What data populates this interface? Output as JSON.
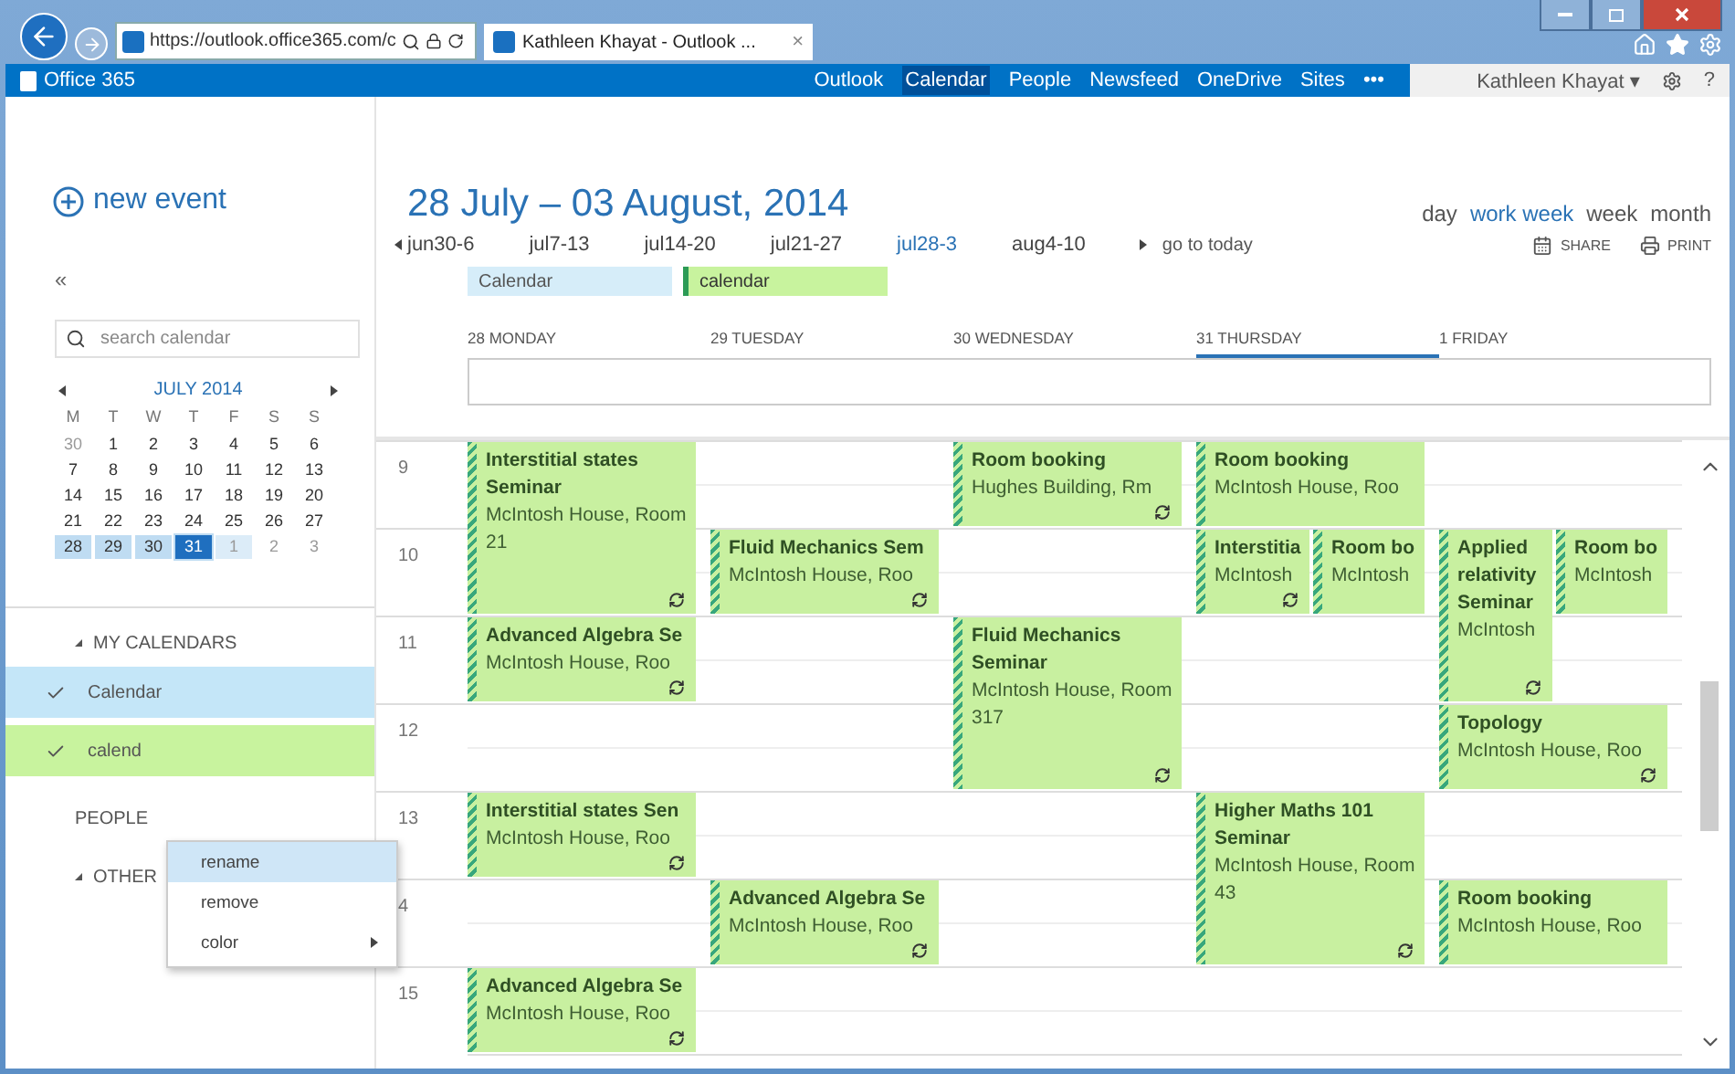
{
  "browser": {
    "address": "https://outlook.office365.com/c",
    "tab": {
      "title": "Kathleen Khayat - Outlook ...",
      "close": "×"
    }
  },
  "suite_bar": {
    "logo": "Office 365",
    "nav": [
      {
        "label": "Outlook",
        "selected": false
      },
      {
        "label": "Calendar",
        "selected": true
      },
      {
        "label": "People",
        "selected": false
      },
      {
        "label": "Newsfeed",
        "selected": false
      },
      {
        "label": "OneDrive",
        "selected": false
      },
      {
        "label": "Sites",
        "selected": false
      }
    ],
    "more": "•••",
    "user": "Kathleen Khayat ▾",
    "help": "?"
  },
  "sidebar": {
    "new_event": "new event",
    "collapse": "«",
    "search": {
      "placeholder": "search calendar"
    },
    "mini_calendar": {
      "month": "JULY 2014",
      "weekdays": [
        "M",
        "T",
        "W",
        "T",
        "F",
        "S",
        "S"
      ],
      "weeks": [
        [
          {
            "label": "30",
            "other_month": true,
            "selected": false,
            "today": false
          },
          {
            "label": "1",
            "other_month": false,
            "selected": false,
            "today": false
          },
          {
            "label": "2",
            "other_month": false,
            "selected": false,
            "today": false
          },
          {
            "label": "3",
            "other_month": false,
            "selected": false,
            "today": false
          },
          {
            "label": "4",
            "other_month": false,
            "selected": false,
            "today": false
          },
          {
            "label": "5",
            "other_month": false,
            "selected": false,
            "today": false
          },
          {
            "label": "6",
            "other_month": false,
            "selected": false,
            "today": false
          }
        ],
        [
          {
            "label": "7",
            "other_month": false,
            "selected": false,
            "today": false
          },
          {
            "label": "8",
            "other_month": false,
            "selected": false,
            "today": false
          },
          {
            "label": "9",
            "other_month": false,
            "selected": false,
            "today": false
          },
          {
            "label": "10",
            "other_month": false,
            "selected": false,
            "today": false
          },
          {
            "label": "11",
            "other_month": false,
            "selected": false,
            "today": false
          },
          {
            "label": "12",
            "other_month": false,
            "selected": false,
            "today": false
          },
          {
            "label": "13",
            "other_month": false,
            "selected": false,
            "today": false
          }
        ],
        [
          {
            "label": "14",
            "other_month": false,
            "selected": false,
            "today": false
          },
          {
            "label": "15",
            "other_month": false,
            "selected": false,
            "today": false
          },
          {
            "label": "16",
            "other_month": false,
            "selected": false,
            "today": false
          },
          {
            "label": "17",
            "other_month": false,
            "selected": false,
            "today": false
          },
          {
            "label": "18",
            "other_month": false,
            "selected": false,
            "today": false
          },
          {
            "label": "19",
            "other_month": false,
            "selected": false,
            "today": false
          },
          {
            "label": "20",
            "other_month": false,
            "selected": false,
            "today": false
          }
        ],
        [
          {
            "label": "21",
            "other_month": false,
            "selected": false,
            "today": false
          },
          {
            "label": "22",
            "other_month": false,
            "selected": false,
            "today": false
          },
          {
            "label": "23",
            "other_month": false,
            "selected": false,
            "today": false
          },
          {
            "label": "24",
            "other_month": false,
            "selected": false,
            "today": false
          },
          {
            "label": "25",
            "other_month": false,
            "selected": false,
            "today": false
          },
          {
            "label": "26",
            "other_month": false,
            "selected": false,
            "today": false
          },
          {
            "label": "27",
            "other_month": false,
            "selected": false,
            "today": false
          }
        ],
        [
          {
            "label": "28",
            "other_month": false,
            "selected": true,
            "today": false
          },
          {
            "label": "29",
            "other_month": false,
            "selected": true,
            "today": false
          },
          {
            "label": "30",
            "other_month": false,
            "selected": true,
            "today": false
          },
          {
            "label": "31",
            "other_month": false,
            "selected": true,
            "today": true
          },
          {
            "label": "1",
            "other_month": true,
            "selected": true,
            "today": false
          },
          {
            "label": "2",
            "other_month": true,
            "selected": false,
            "today": false
          },
          {
            "label": "3",
            "other_month": true,
            "selected": false,
            "today": false
          }
        ]
      ]
    },
    "sections": [
      {
        "label": "MY CALENDARS",
        "expanded": true,
        "items": [
          {
            "label": "Calendar",
            "checked": true,
            "color": "#c4e6f8"
          },
          {
            "label": "calend",
            "checked": true,
            "color": "#c8f39e"
          }
        ]
      },
      {
        "label": "PEOPLE",
        "expanded": false
      },
      {
        "label": "OTHER",
        "expanded": true
      }
    ],
    "context_menu": [
      {
        "label": "rename",
        "selected": true,
        "submenu": false
      },
      {
        "label": "remove",
        "selected": false,
        "submenu": false
      },
      {
        "label": "color",
        "selected": false,
        "submenu": true
      }
    ]
  },
  "header": {
    "title": "28 July – 03 August, 2014",
    "views": [
      {
        "label": "day",
        "selected": false
      },
      {
        "label": "work week",
        "selected": true
      },
      {
        "label": "week",
        "selected": false
      },
      {
        "label": "month",
        "selected": false
      }
    ],
    "weeks": [
      {
        "label": "jun30-6",
        "selected": false
      },
      {
        "label": "jul7-13",
        "selected": false
      },
      {
        "label": "jul14-20",
        "selected": false
      },
      {
        "label": "jul21-27",
        "selected": false
      },
      {
        "label": "jul28-3",
        "selected": true
      },
      {
        "label": "aug4-10",
        "selected": false
      }
    ],
    "go_to_today": "go to today",
    "share": "SHARE",
    "print": "PRINT",
    "calendars": [
      {
        "label": "Calendar",
        "color": "#d6edf9"
      },
      {
        "label": "calendar",
        "color": "#c8f39e"
      }
    ]
  },
  "hours": [
    "9",
    "10",
    "11",
    "12",
    "13",
    "4",
    "15"
  ],
  "days": [
    {
      "label": "28 MONDAY",
      "selected": false,
      "blocks": [
        {
          "kind": "two-hours",
          "title": "Interstitial states Seminar",
          "location": "McIntosh House, Room 21",
          "recurring": true
        },
        {
          "kind": "hour",
          "title": "Advanced Algebra Se",
          "location": "McIntosh House, Roo",
          "recurring": true
        },
        {
          "kind": "free"
        },
        {
          "kind": "hour",
          "title": "Interstitial states Sen",
          "location": "McIntosh House, Roo",
          "recurring": true
        },
        {
          "kind": "free"
        },
        {
          "kind": "hour",
          "title": "Advanced Algebra Se",
          "location": "McIntosh House, Roo",
          "recurring": true
        }
      ]
    },
    {
      "label": "29 TUESDAY",
      "selected": false,
      "blocks": [
        {
          "kind": "free"
        },
        {
          "kind": "hour",
          "title": "Fluid Mechanics Sem",
          "location": "McIntosh House, Roo",
          "recurring": true
        },
        {
          "kind": "free"
        },
        {
          "kind": "free"
        },
        {
          "kind": "free"
        },
        {
          "kind": "hour",
          "title": "Advanced Algebra Se",
          "location": "McIntosh House, Roo",
          "recurring": true
        }
      ]
    },
    {
      "label": "30 WEDNESDAY",
      "selected": false,
      "blocks": [
        {
          "kind": "hour",
          "title": "Room booking",
          "location": "Hughes Building, Rm",
          "recurring": true
        },
        {
          "kind": "free"
        },
        {
          "kind": "two-hours",
          "title": "Fluid Mechanics Seminar",
          "location": "McIntosh House, Room 317",
          "recurring": true
        }
      ]
    },
    {
      "label": "31 THURSDAY",
      "selected": true,
      "blocks": [
        {
          "kind": "hour",
          "title": "Room booking",
          "location": "McIntosh House, Roo",
          "recurring": false
        },
        {
          "kind": "pair",
          "events": [
            {
              "kind": "hour",
              "title": "Interstitia",
              "location": "McIntosh",
              "recurring": true
            },
            {
              "kind": "hour",
              "title": "Room bo",
              "location": "McIntosh",
              "recurring": false
            }
          ]
        },
        {
          "kind": "free"
        },
        {
          "kind": "free"
        },
        {
          "kind": "two-hours",
          "title": "Higher Maths 101 Seminar",
          "location": "McIntosh House, Room 43",
          "recurring": true
        }
      ]
    },
    {
      "label": "1 FRIDAY",
      "selected": false,
      "blocks": [
        {
          "kind": "free"
        },
        {
          "kind": "pair",
          "events": [
            {
              "kind": "two-hours",
              "title": "Applied relativity Seminar",
              "location": "McIntosh",
              "recurring": true
            },
            {
              "kind": "hour",
              "title": "Room bo",
              "location": "McIntosh",
              "recurring": false
            }
          ]
        },
        {
          "kind": "hour",
          "title": "Topology",
          "location": "McIntosh House, Roo",
          "recurring": true
        },
        {
          "kind": "free"
        },
        {
          "kind": "hour",
          "title": "Room booking",
          "location": "McIntosh House, Roo",
          "recurring": false
        }
      ]
    }
  ]
}
